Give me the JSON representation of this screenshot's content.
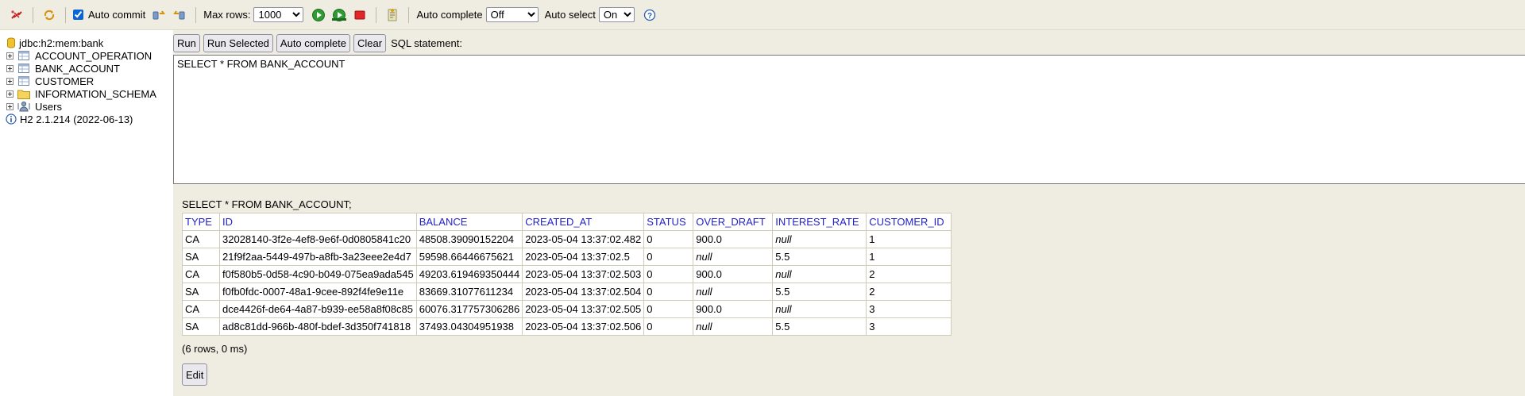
{
  "toolbar": {
    "auto_commit_label": "Auto commit",
    "auto_commit_checked": true,
    "max_rows_label": "Max rows:",
    "max_rows_value": "1000",
    "auto_complete_label": "Auto complete",
    "auto_complete_value": "Off",
    "auto_select_label": "Auto select",
    "auto_select_value": "On"
  },
  "tree": {
    "connection": "jdbc:h2:mem:bank",
    "items": [
      {
        "label": "ACCOUNT_OPERATION",
        "icon": "table-icon"
      },
      {
        "label": "BANK_ACCOUNT",
        "icon": "table-icon"
      },
      {
        "label": "CUSTOMER",
        "icon": "table-icon"
      },
      {
        "label": "INFORMATION_SCHEMA",
        "icon": "folder-icon"
      },
      {
        "label": "Users",
        "icon": "users-icon"
      }
    ],
    "version": "H2 2.1.214 (2022-06-13)"
  },
  "buttons": {
    "run": "Run",
    "run_selected": "Run Selected",
    "auto_complete": "Auto complete",
    "clear": "Clear",
    "sql_statement_label": "SQL statement:"
  },
  "editor": {
    "sql": "SELECT * FROM BANK_ACCOUNT"
  },
  "results": {
    "query": "SELECT * FROM BANK_ACCOUNT;",
    "columns": [
      "TYPE",
      "ID",
      "BALANCE",
      "CREATED_AT",
      "STATUS",
      "OVER_DRAFT",
      "INTEREST_RATE",
      "CUSTOMER_ID"
    ],
    "rows": [
      [
        "CA",
        "32028140-3f2e-4ef8-9e6f-0d0805841c20",
        "48508.39090152204",
        "2023-05-04 13:37:02.482",
        "0",
        "900.0",
        "null",
        "1"
      ],
      [
        "SA",
        "21f9f2aa-5449-497b-a8fb-3a23eee2e4d7",
        "59598.66446675621",
        "2023-05-04 13:37:02.5",
        "0",
        "null",
        "5.5",
        "1"
      ],
      [
        "CA",
        "f0f580b5-0d58-4c90-b049-075ea9ada545",
        "49203.619469350444",
        "2023-05-04 13:37:02.503",
        "0",
        "900.0",
        "null",
        "2"
      ],
      [
        "SA",
        "f0fb0fdc-0007-48a1-9cee-892f4fe9e11e",
        "83669.31077611234",
        "2023-05-04 13:37:02.504",
        "0",
        "null",
        "5.5",
        "2"
      ],
      [
        "CA",
        "dce4426f-de64-4a87-b939-ee58a8f08c85",
        "60076.317757306286",
        "2023-05-04 13:37:02.505",
        "0",
        "900.0",
        "null",
        "3"
      ],
      [
        "SA",
        "ad8c81dd-966b-480f-bdef-3d350f741818",
        "37493.04304951938",
        "2023-05-04 13:37:02.506",
        "0",
        "null",
        "5.5",
        "3"
      ]
    ],
    "summary": "(6 rows, 0 ms)",
    "edit_label": "Edit"
  }
}
